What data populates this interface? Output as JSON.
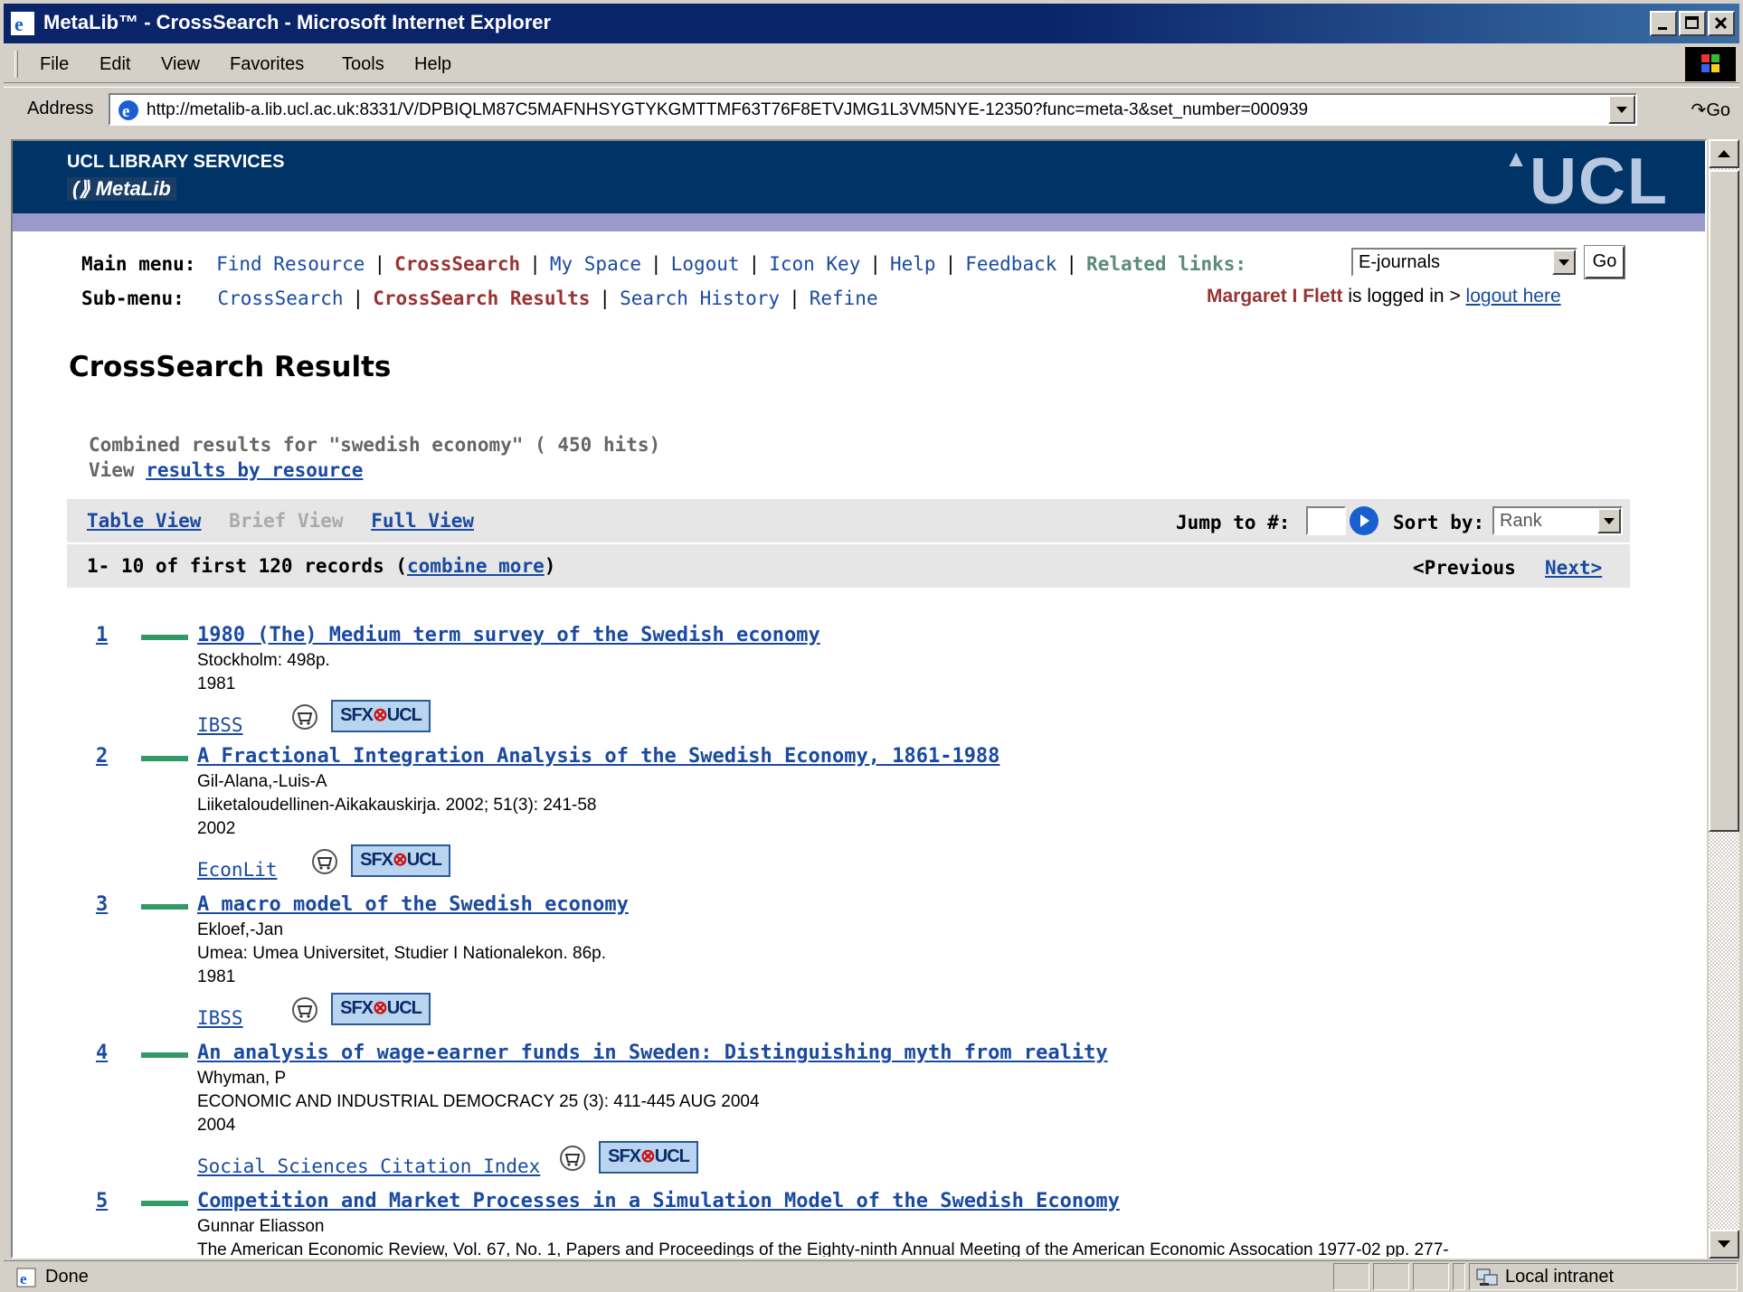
{
  "window": {
    "title": "MetaLib™ - CrossSearch - Microsoft Internet Explorer"
  },
  "menu": [
    "File",
    "Edit",
    "View",
    "Favorites",
    "Tools",
    "Help"
  ],
  "address": {
    "label": "Address",
    "url": "http://metalib-a.lib.ucl.ac.uk:8331/V/DPBIQLM87C5MAFNHSYGTYKGMTTMF63T76F8ETVJMG1L3VM5NYE-12350?func=meta-3&set_number=000939",
    "go": "Go"
  },
  "header": {
    "org": "UCL LIBRARY SERVICES",
    "product": "MetaLib",
    "logo": "UCL"
  },
  "mainmenu": {
    "label": "Main menu:",
    "items": [
      "Find Resource",
      "CrossSearch",
      "My Space",
      "Logout",
      "Icon Key",
      "Help",
      "Feedback"
    ],
    "related_label": "Related links:",
    "related_value": "E-journals",
    "go": "Go"
  },
  "submenu": {
    "label": "Sub-menu:",
    "items": [
      "CrossSearch",
      "CrossSearch Results",
      "Search History",
      "Refine"
    ]
  },
  "login": {
    "name": "Margaret I Flett",
    "text": " is logged in > ",
    "link": "logout here"
  },
  "page": {
    "title": "CrossSearch Results",
    "combined": "Combined results for \"swedish economy\" ( 450 hits)",
    "view_prefix": "View ",
    "view_link": "results by resource"
  },
  "views": {
    "table": "Table View",
    "brief": "Brief View",
    "full": "Full View",
    "jump": "Jump to #:",
    "sort": "Sort by:",
    "sort_value": "Rank"
  },
  "paging": {
    "range": "1- 10 of first 120 records (",
    "combine": "combine more",
    "close": ")",
    "prev": "<Previous",
    "next": "Next>"
  },
  "records": [
    {
      "num": "1",
      "title": "1980 (The) Medium term survey of the Swedish economy",
      "lines": [
        "Stockholm: 498p.",
        "1981"
      ],
      "source": "IBSS"
    },
    {
      "num": "2",
      "title": "A Fractional Integration Analysis of the Swedish Economy, 1861-1988",
      "lines": [
        "Gil-Alana,-Luis-A",
        "Liiketaloudellinen-Aikakauskirja. 2002; 51(3): 241-58",
        "2002"
      ],
      "source": "EconLit"
    },
    {
      "num": "3",
      "title": "A macro model of the Swedish economy",
      "lines": [
        "Ekloef,-Jan",
        "Umea: Umea Universitet, Studier I Nationalekon. 86p.",
        "1981"
      ],
      "source": "IBSS"
    },
    {
      "num": "4",
      "title": "An analysis of wage-earner funds in Sweden: Distinguishing myth from reality",
      "lines": [
        "Whyman, P",
        "ECONOMIC AND INDUSTRIAL DEMOCRACY 25 (3): 411-445 AUG 2004",
        "2004"
      ],
      "source": "Social Sciences Citation Index"
    },
    {
      "num": "5",
      "title": "Competition and Market Processes in a Simulation Model of the Swedish Economy",
      "lines": [
        "Gunnar Eliasson",
        "The American Economic Review, Vol. 67, No. 1, Papers and Proceedings of the Eighty-ninth Annual Meeting of the American Economic Assocation 1977-02 pp. 277-"
      ],
      "source": ""
    }
  ],
  "sfx": {
    "a": "SFX",
    "b": "UCL"
  },
  "status": {
    "text": "Done",
    "zone": "Local intranet"
  }
}
